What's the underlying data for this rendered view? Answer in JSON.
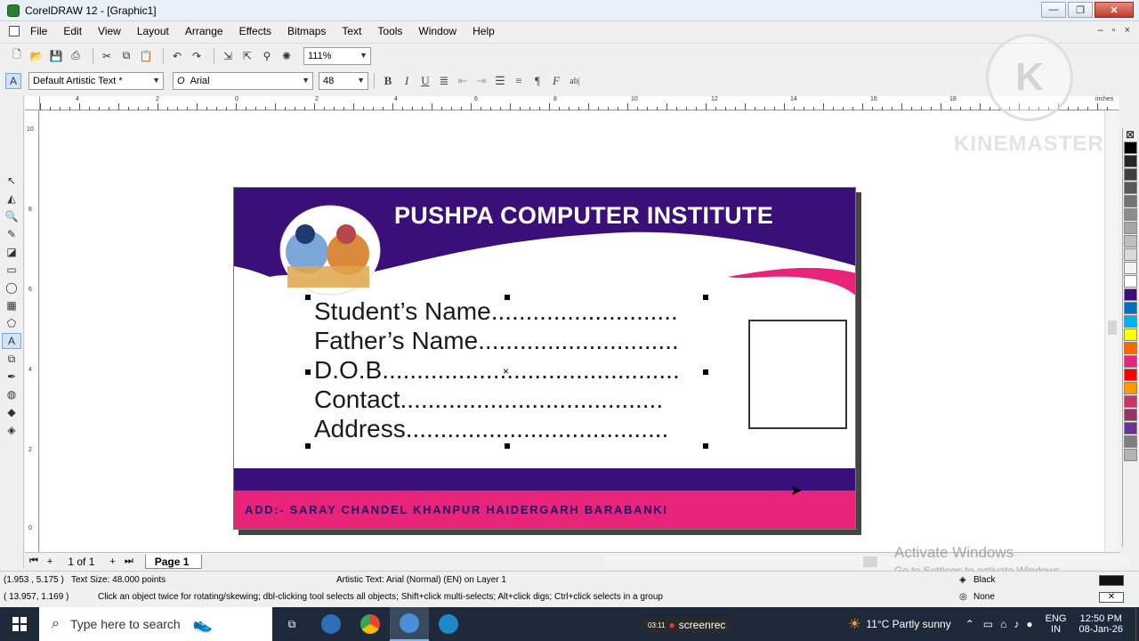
{
  "window": {
    "title": "CorelDRAW 12 - [Graphic1]",
    "buttons": {
      "minimize": "—",
      "restore": "❐",
      "close": "✕"
    }
  },
  "menu": {
    "items": [
      "File",
      "Edit",
      "View",
      "Layout",
      "Arrange",
      "Effects",
      "Bitmaps",
      "Text",
      "Tools",
      "Window",
      "Help"
    ]
  },
  "toolbar": {
    "zoom": "111%",
    "style": "Default Artistic Text *",
    "font": "Arial",
    "font_size": "48"
  },
  "ruler": {
    "top_labels": [
      "4",
      "2",
      "0",
      "2",
      "4",
      "6",
      "8",
      "10",
      "12",
      "14",
      "16",
      "18"
    ],
    "left_labels": [
      "10",
      "8",
      "6",
      "4",
      "2",
      "0"
    ],
    "units": "inches"
  },
  "card": {
    "title": "PUSHPA COMPUTER INSTITUTE",
    "fields": [
      "Student’s Name...........................",
      "Father’s Name.............................",
      "D.O.B...........................................",
      "Contact......................................",
      "Address......................................"
    ],
    "address": "ADD:- SARAY CHANDEL KHANPUR HAIDERGARH BARABANKI",
    "colors": {
      "purple": "#3a0f7a",
      "pink": "#e8247a"
    }
  },
  "watermark": {
    "logo_letter": "K",
    "text": "KINEMASTER"
  },
  "palette": [
    "#000000",
    "#262626",
    "#404040",
    "#595959",
    "#737373",
    "#8c8c8c",
    "#a6a6a6",
    "#bfbfbf",
    "#d9d9d9",
    "#f2f2f2",
    "#ffffff",
    "#3a0f7a",
    "#0070c0",
    "#00b0f0",
    "#ffff00",
    "#ff6600",
    "#e8247a",
    "#ff0000",
    "#ff9900",
    "#cc3366",
    "#993366",
    "#663399",
    "#7f7f7f",
    "#b3b3b3"
  ],
  "pages": {
    "counter": "1 of 1",
    "tab": "Page 1"
  },
  "status": {
    "coords1": "(1.953 , 5.175 )",
    "text_size": "Text Size: 48.000 points",
    "object_info": "Artistic Text: Arial (Normal) (EN) on Layer 1",
    "coords2": "( 13.957, 1.169 )",
    "hint": "Click an object twice for rotating/skewing; dbl-clicking tool selects all objects; Shift+click multi-selects; Alt+click digs; Ctrl+click selects in a group",
    "fill": "Black",
    "outline": "None"
  },
  "activate": {
    "title": "Activate Windows",
    "subtitle": "Go to Settings to activate Windows."
  },
  "taskbar": {
    "search_placeholder": "Type here to search",
    "recorder": "screenrec",
    "recorder_time": "03:11",
    "weather": "11°C  Partly sunny",
    "lang": "ENG",
    "region": "IN",
    "time": "12:50 PM",
    "date": "08-Jan-26"
  }
}
